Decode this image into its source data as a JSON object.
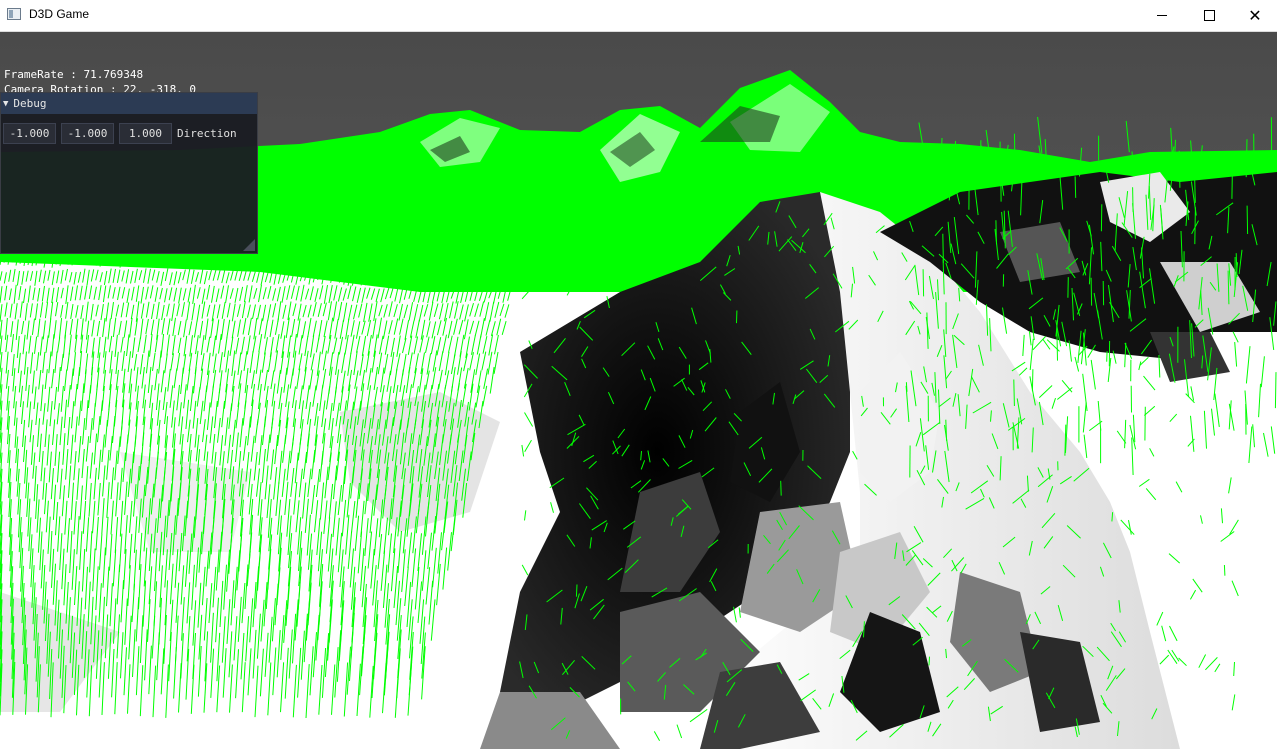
{
  "window": {
    "title": "D3D Game",
    "icon": "app-icon",
    "controls": {
      "minimize": "minimize-icon",
      "maximize": "maximize-icon",
      "close": "close-icon",
      "close_glyph": "✕"
    }
  },
  "overlay": {
    "framerate": "FrameRate : 71.769348",
    "camera_rotation": "Camera Rotation : 22, -318, 0"
  },
  "debug": {
    "title": "Debug",
    "direction_values": [
      "-1.000",
      "-1.000",
      "1.000"
    ],
    "direction_label": "Direction"
  },
  "scene": {
    "sky_color": "#4d4d4d",
    "normal_line_color": "#00ff00",
    "terrain_light": "#ffffff",
    "terrain_dark": "#000000"
  }
}
